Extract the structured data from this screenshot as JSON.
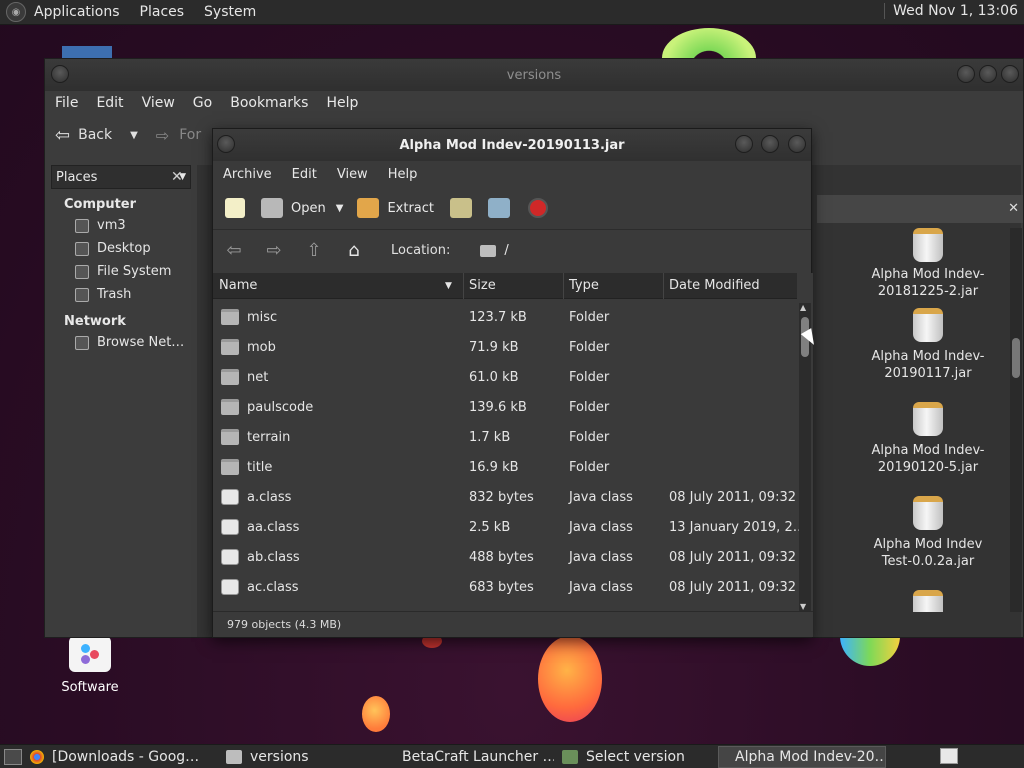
{
  "top_panel": {
    "menus": [
      "Applications",
      "Places",
      "System"
    ],
    "clock": "Wed Nov 1, 13:06"
  },
  "desktop": {
    "software_label": "Software"
  },
  "versions_window": {
    "title": "versions",
    "menus": [
      "File",
      "Edit",
      "View",
      "Go",
      "Bookmarks",
      "Help"
    ],
    "back_label": "Back",
    "forward_label_partial": "For",
    "sidebar": {
      "header": "Places",
      "categories": [
        {
          "label": "Computer",
          "items": [
            "vm3",
            "Desktop",
            "File System",
            "Trash"
          ]
        },
        {
          "label": "Network",
          "items": [
            "Browse Net…"
          ]
        }
      ]
    },
    "files": [
      {
        "label": "Alpha Mod Indev-20181225-2.jar"
      },
      {
        "label": "Alpha Mod Indev-20190117.jar"
      },
      {
        "label": "Alpha Mod Indev-20190120-5.jar"
      },
      {
        "label": "Alpha Mod Indev Test-0.0.2a.jar"
      }
    ]
  },
  "archive_window": {
    "title": "Alpha Mod Indev-20190113.jar",
    "menus": [
      "Archive",
      "Edit",
      "View",
      "Help"
    ],
    "toolbar": {
      "open_label": "Open",
      "extract_label": "Extract"
    },
    "location_label": "Location:",
    "location_path": "/",
    "columns": [
      "Name",
      "Size",
      "Type",
      "Date Modified"
    ],
    "rows": [
      {
        "name": "misc",
        "size": "123.7 kB",
        "type": "Folder",
        "date": "",
        "kind": "folder"
      },
      {
        "name": "mob",
        "size": "71.9 kB",
        "type": "Folder",
        "date": "",
        "kind": "folder"
      },
      {
        "name": "net",
        "size": "61.0 kB",
        "type": "Folder",
        "date": "",
        "kind": "folder"
      },
      {
        "name": "paulscode",
        "size": "139.6 kB",
        "type": "Folder",
        "date": "",
        "kind": "folder"
      },
      {
        "name": "terrain",
        "size": "1.7 kB",
        "type": "Folder",
        "date": "",
        "kind": "folder"
      },
      {
        "name": "title",
        "size": "16.9 kB",
        "type": "Folder",
        "date": "",
        "kind": "folder"
      },
      {
        "name": "a.class",
        "size": "832 bytes",
        "type": "Java class",
        "date": "08 July 2011, 09:32",
        "kind": "java"
      },
      {
        "name": "aa.class",
        "size": "2.5 kB",
        "type": "Java class",
        "date": "13 January 2019, 2…",
        "kind": "java"
      },
      {
        "name": "ab.class",
        "size": "488 bytes",
        "type": "Java class",
        "date": "08 July 2011, 09:32",
        "kind": "java"
      },
      {
        "name": "ac.class",
        "size": "683 bytes",
        "type": "Java class",
        "date": "08 July 2011, 09:32",
        "kind": "java"
      }
    ],
    "status": "979 objects (4.3 MB)"
  },
  "taskbar": {
    "items": [
      {
        "label": "[Downloads - Goog…",
        "active": false
      },
      {
        "label": "versions",
        "active": false
      },
      {
        "label": "BetaCraft Launcher …",
        "active": false
      },
      {
        "label": "Select version",
        "active": false
      },
      {
        "label": "Alpha Mod Indev-20…",
        "active": true
      }
    ]
  }
}
